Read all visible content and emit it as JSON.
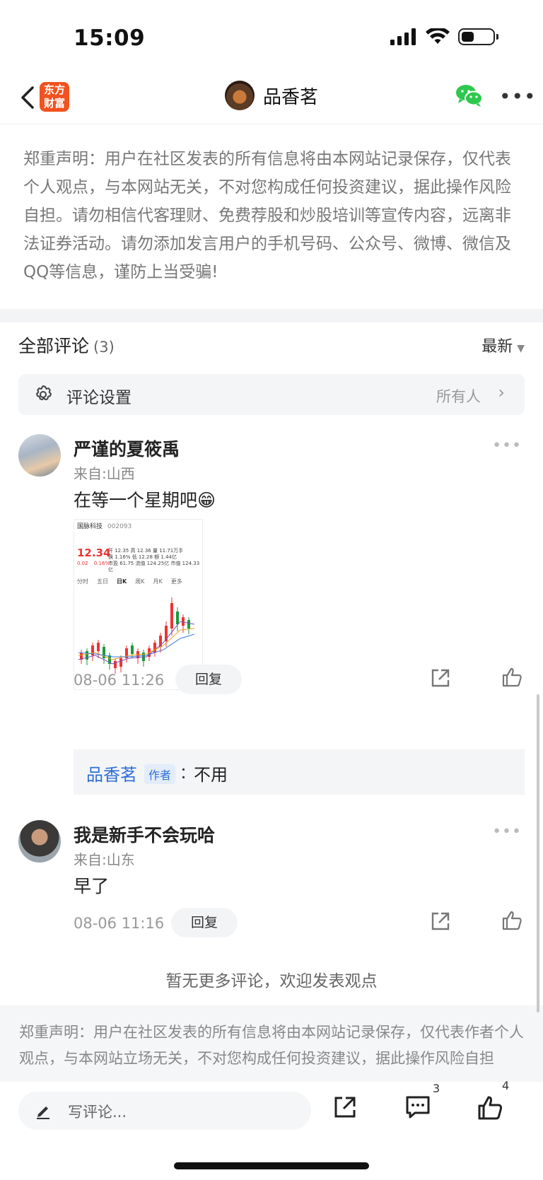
{
  "status_bar": {
    "time": "15:09",
    "battery_level": 0.4
  },
  "nav": {
    "back_label": "",
    "logo_line1": "东方",
    "logo_line2": "财富",
    "title": "品香茗"
  },
  "disclaimer": "郑重声明：用户在社区发表的所有信息将由本网站记录保存，仅代表个人观点，与本网站无关，不对您构成任何投资建议，据此操作风险自担。请勿相信代客理财、免费荐股和炒股培训等宣传内容，远离非法证券活动。请勿添加发言用户的手机号码、公众号、微博、微信及QQ等信息，谨防上当受骗!",
  "comments_header": {
    "title": "全部评论",
    "count": "(3)",
    "sort": "最新"
  },
  "comment_settings": {
    "label": "评论设置",
    "value": "所有人"
  },
  "comments": [
    {
      "name": "严谨的夏筱禹",
      "location": "来自:山西",
      "text": "在等一个星期吧😁",
      "time": "08-06 11:26",
      "reply_label": "回复",
      "thumbnail": {
        "title": "国脉科技",
        "code": "002093",
        "price": "12.34",
        "change": "0.02",
        "change_pct": "0.16%",
        "tabs": [
          "分时",
          "五日",
          "日K",
          "周K",
          "月K",
          "更多"
        ],
        "stats": [
          "开 12.35",
          "高 12.36",
          "量 11.71万手",
          "换 1.16%",
          "低 12.28",
          "额 1.44亿",
          "市盈 61.75",
          "流值 124.25亿",
          "市值 124.33亿"
        ]
      },
      "author_reply": {
        "name": "品香茗",
        "tag": "作者",
        "colon": "：",
        "text": "不用"
      }
    },
    {
      "name": "我是新手不会玩哈",
      "location": "来自:山东",
      "text": "早了",
      "time": "08-06 11:16",
      "reply_label": "回复"
    }
  ],
  "no_more": "暂无更多评论，欢迎发表观点",
  "footer_disclaimer": "郑重声明：用户在社区发表的所有信息将由本网站记录保存，仅代表作者个人观点，与本网站立场无关，不对您构成任何投资建议，据此操作风险自担",
  "bottom_bar": {
    "placeholder": "写评论...",
    "comment_count": "3",
    "like_count": "4"
  },
  "colors": {
    "brand": "#f1521f",
    "link": "#2d6fd6",
    "wechat": "#2dc84d"
  }
}
